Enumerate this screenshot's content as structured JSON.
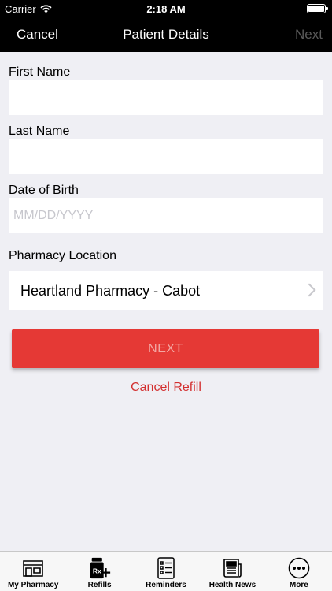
{
  "status_bar": {
    "carrier": "Carrier",
    "time": "2:18 AM"
  },
  "nav": {
    "cancel_label": "Cancel",
    "title": "Patient Details",
    "next_label": "Next"
  },
  "form": {
    "first_name": {
      "label": "First Name",
      "value": "",
      "placeholder": ""
    },
    "last_name": {
      "label": "Last Name",
      "value": "",
      "placeholder": ""
    },
    "dob": {
      "label": "Date of Birth",
      "value": "",
      "placeholder": "MM/DD/YYYY"
    },
    "pharmacy": {
      "label": "Pharmacy Location",
      "value": "Heartland Pharmacy - Cabot"
    }
  },
  "actions": {
    "next_button": "NEXT",
    "cancel_refill": "Cancel Refill"
  },
  "tabbar": {
    "items": [
      {
        "label": "My Pharmacy",
        "icon": "storefront-icon"
      },
      {
        "label": "Refills",
        "icon": "rx-bottle-icon",
        "icon_text": "Rx"
      },
      {
        "label": "Reminders",
        "icon": "checklist-icon"
      },
      {
        "label": "Health News",
        "icon": "newspaper-icon"
      },
      {
        "label": "More",
        "icon": "more-dots-icon"
      }
    ]
  },
  "colors": {
    "accent_red": "#e53935",
    "link_red": "#d32f2f",
    "nav_bg": "#000000",
    "page_bg": "#efeff4"
  }
}
